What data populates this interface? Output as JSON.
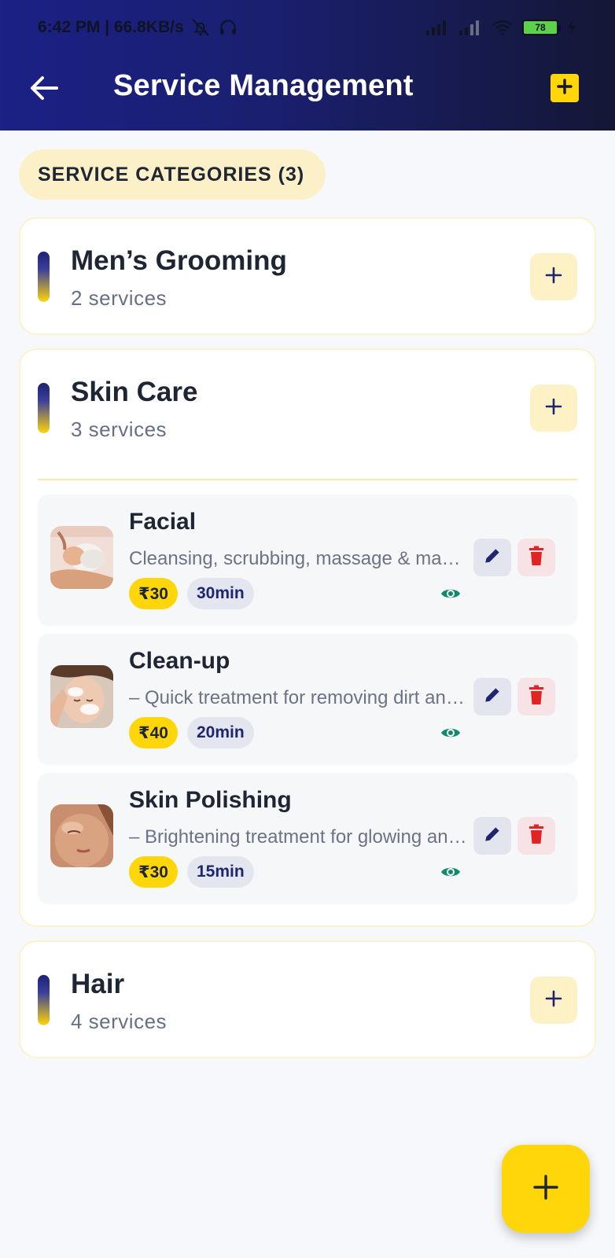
{
  "status_bar": {
    "time_speed": "6:42 PM | 66.8KB/s",
    "battery": "78",
    "icons": [
      "mute-bell-icon",
      "headphones-icon",
      "signal-icon",
      "signal-icon",
      "wifi-icon",
      "battery-icon",
      "charging-icon"
    ]
  },
  "appbar": {
    "title": "Service Management",
    "back_icon": "arrow-left-icon",
    "add_icon": "plus-icon"
  },
  "section": {
    "label": "SERVICE CATEGORIES (3)"
  },
  "categories": [
    {
      "title": "Men’s Grooming",
      "count": "2 services",
      "expanded": false
    },
    {
      "title": "Skin Care",
      "count": "3 services",
      "expanded": true,
      "services": [
        {
          "name": "Facial",
          "description": "Cleansing, scrubbing, massage & mask for deep skin care",
          "price": "₹30",
          "duration": "30min"
        },
        {
          "name": "Clean-up",
          "description": "– Quick treatment for removing dirt and oil from skin",
          "price": "₹40",
          "duration": "20min"
        },
        {
          "name": "Skin Polishing",
          "description": "– Brightening treatment for glowing and smooth skin",
          "price": "₹30",
          "duration": "15min"
        }
      ]
    },
    {
      "title": "Hair",
      "count": "4 services",
      "expanded": false
    }
  ],
  "colors": {
    "header_start": "#1b2185",
    "header_end": "#141735",
    "accent_yellow": "#ffd60a",
    "pill_bg": "#fbf0c8",
    "visible_green": "#0f8a6b",
    "delete_red": "#e02424",
    "edit_navy": "#1f2670"
  }
}
